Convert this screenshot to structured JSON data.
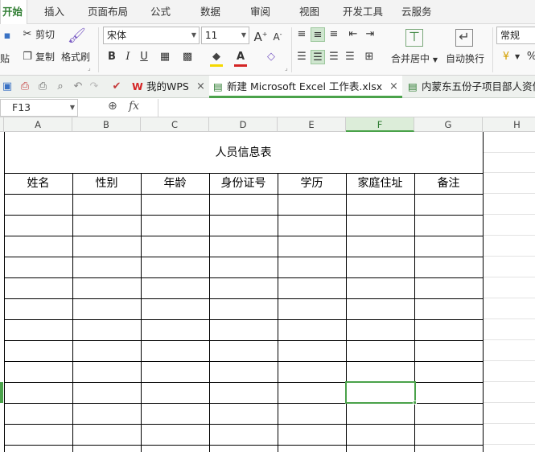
{
  "menu": {
    "tabs": [
      "开始",
      "插入",
      "页面布局",
      "公式",
      "数据",
      "审阅",
      "视图",
      "开发工具",
      "云服务"
    ]
  },
  "ribbon": {
    "clipboard": {
      "cut": "剪切",
      "copy": "复制",
      "format_painter": "格式刷",
      "paste_partial": "贴"
    },
    "font": {
      "name": "宋体",
      "size": "11",
      "bold": "B",
      "italic": "I",
      "underline": "U",
      "grow": "A",
      "shrink": "A"
    },
    "alignment": {
      "merge_center": "合并居中",
      "wrap_text": "自动换行"
    },
    "number": {
      "format": "常规",
      "percent": "%"
    }
  },
  "quickbar": {
    "doc_tabs": [
      {
        "label": "我的WPS",
        "close": "×"
      },
      {
        "label": "新建 Microsoft Excel 工作表.xlsx",
        "close": "×"
      },
      {
        "label": "内蒙东五份子项目部人资信"
      }
    ]
  },
  "formula_bar": {
    "name_box": "F13",
    "fx": "fx"
  },
  "sheet": {
    "columns": [
      "A",
      "B",
      "C",
      "D",
      "E",
      "F",
      "G",
      "H"
    ],
    "selected_column": "F",
    "title": "人员信息表",
    "headers": [
      "姓名",
      "性别",
      "年龄",
      "身份证号",
      "学历",
      "家庭住址",
      "备注"
    ]
  },
  "colors": {
    "accent": "#4aa24a",
    "active_tab_text": "#2f7d32"
  }
}
